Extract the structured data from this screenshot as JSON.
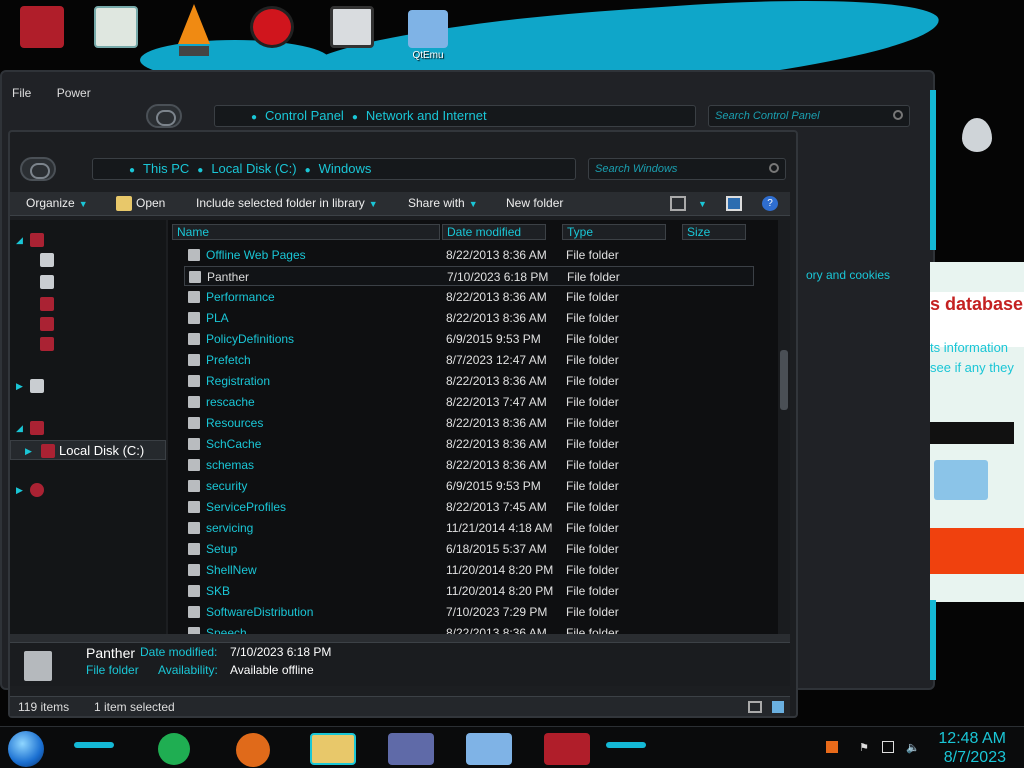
{
  "desktop": {
    "icons": [
      {
        "label": ""
      },
      {
        "label": ""
      },
      {
        "label": ""
      },
      {
        "label": ""
      },
      {
        "label": ""
      },
      {
        "label": "QtEmu"
      }
    ],
    "right_panel_texts": [
      "ory and cookies",
      "s database",
      "ts information",
      "see if any they"
    ]
  },
  "control_panel": {
    "menu": [
      "File",
      "Power"
    ],
    "breadcrumb": [
      "Control Panel",
      "Network and Internet"
    ],
    "search_placeholder": "Search Control Panel"
  },
  "explorer": {
    "breadcrumb": [
      "This PC",
      "Local Disk (C:)",
      "Windows"
    ],
    "search_placeholder": "Search Windows",
    "toolbar": {
      "organize": "Organize",
      "open": "Open",
      "include": "Include selected folder in library",
      "share": "Share with",
      "new_folder": "New folder"
    },
    "nav": {
      "selected": "Local Disk (C:)"
    },
    "columns": {
      "name": "Name",
      "date": "Date modified",
      "type": "Type",
      "size": "Size"
    },
    "files": [
      {
        "name": "Offline Web Pages",
        "date": "8/22/2013 8:36 AM",
        "type": "File folder"
      },
      {
        "name": "Panther",
        "date": "7/10/2023 6:18 PM",
        "type": "File folder"
      },
      {
        "name": "Performance",
        "date": "8/22/2013 8:36 AM",
        "type": "File folder"
      },
      {
        "name": "PLA",
        "date": "8/22/2013 8:36 AM",
        "type": "File folder"
      },
      {
        "name": "PolicyDefinitions",
        "date": "6/9/2015 9:53 PM",
        "type": "File folder"
      },
      {
        "name": "Prefetch",
        "date": "8/7/2023 12:47 AM",
        "type": "File folder"
      },
      {
        "name": "Registration",
        "date": "8/22/2013 8:36 AM",
        "type": "File folder"
      },
      {
        "name": "rescache",
        "date": "8/22/2013 7:47 AM",
        "type": "File folder"
      },
      {
        "name": "Resources",
        "date": "8/22/2013 8:36 AM",
        "type": "File folder"
      },
      {
        "name": "SchCache",
        "date": "8/22/2013 8:36 AM",
        "type": "File folder"
      },
      {
        "name": "schemas",
        "date": "8/22/2013 8:36 AM",
        "type": "File folder"
      },
      {
        "name": "security",
        "date": "6/9/2015 9:53 PM",
        "type": "File folder"
      },
      {
        "name": "ServiceProfiles",
        "date": "8/22/2013 7:45 AM",
        "type": "File folder"
      },
      {
        "name": "servicing",
        "date": "11/21/2014 4:18 AM",
        "type": "File folder"
      },
      {
        "name": "Setup",
        "date": "6/18/2015 5:37 AM",
        "type": "File folder"
      },
      {
        "name": "ShellNew",
        "date": "11/20/2014 8:20 PM",
        "type": "File folder"
      },
      {
        "name": "SKB",
        "date": "11/20/2014 8:20 PM",
        "type": "File folder"
      },
      {
        "name": "SoftwareDistribution",
        "date": "7/10/2023 7:29 PM",
        "type": "File folder"
      },
      {
        "name": "Speech",
        "date": "8/22/2013 8:36 AM",
        "type": "File folder"
      }
    ],
    "selected_index": 1,
    "details": {
      "name": "Panther",
      "type": "File folder",
      "date_label": "Date modified:",
      "date_value": "7/10/2023 6:18 PM",
      "avail_label": "Availability:",
      "avail_value": "Available offline"
    },
    "status": {
      "count": "119 items",
      "selected": "1 item selected"
    }
  },
  "taskbar": {
    "time": "12:48 AM",
    "date": "8/7/2023"
  },
  "colors": {
    "accent": "#1ac6d6",
    "window": "#1c1e21"
  }
}
